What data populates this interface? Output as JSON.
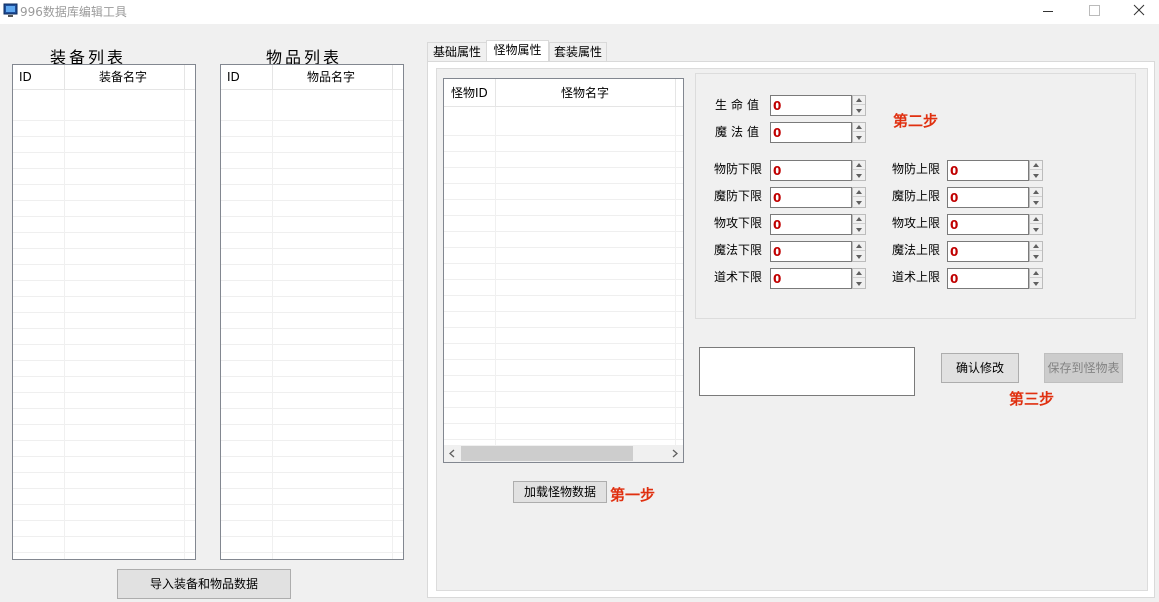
{
  "window": {
    "title": "996数据库编辑工具"
  },
  "left": {
    "equip_title": "装备列表",
    "item_title": "物品列表",
    "equip_columns": [
      "ID",
      "装备名字"
    ],
    "item_columns": [
      "ID",
      "物品名字"
    ],
    "import_button": "导入装备和物品数据"
  },
  "tabs": [
    "基础属性",
    "怪物属性",
    "套装属性"
  ],
  "active_tab": "怪物属性",
  "monster_list": {
    "columns": [
      "怪物ID",
      "怪物名字"
    ]
  },
  "load_button": "加载怪物数据",
  "steps": {
    "step1": "第一步",
    "step2": "第二步",
    "step3": "第三步"
  },
  "fields": {
    "hp": {
      "label": "生命值",
      "value": "0"
    },
    "mp": {
      "label": "魔法值",
      "value": "0"
    },
    "pairs": [
      {
        "low_label": "物防下限",
        "low_value": "0",
        "high_label": "物防上限",
        "high_value": "0"
      },
      {
        "low_label": "魔防下限",
        "low_value": "0",
        "high_label": "魔防上限",
        "high_value": "0"
      },
      {
        "low_label": "物攻下限",
        "low_value": "0",
        "high_label": "物攻上限",
        "high_value": "0"
      },
      {
        "low_label": "魔法下限",
        "low_value": "0",
        "high_label": "魔法上限",
        "high_value": "0"
      },
      {
        "low_label": "道术下限",
        "low_value": "0",
        "high_label": "道术上限",
        "high_value": "0"
      }
    ]
  },
  "confirm_button": "确认修改",
  "save_button": "保存到怪物表",
  "colors": {
    "step_accent": "#e03010",
    "value_text": "#c00000"
  }
}
